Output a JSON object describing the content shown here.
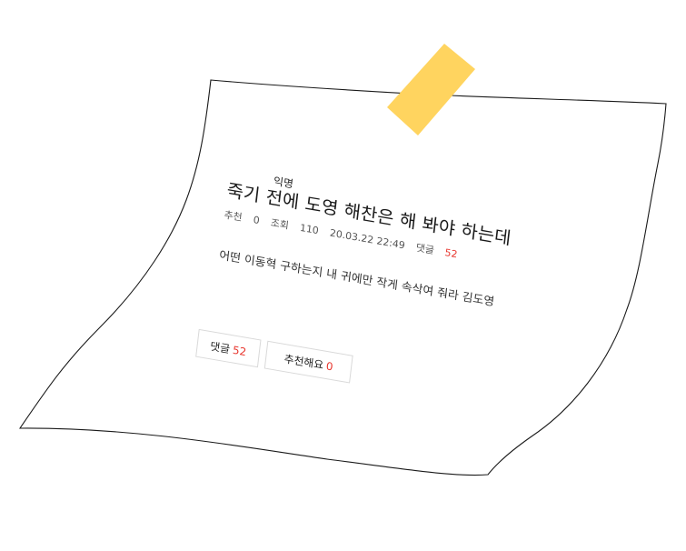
{
  "post": {
    "author": "익명",
    "title": "죽기 전에 도영 해찬은 해 봐야 하는데",
    "meta": {
      "recommend_label": "추천",
      "recommend_count": "0",
      "views_label": "조회",
      "views_count": "110",
      "datetime": "20.03.22 22:49",
      "comments_label": "댓글",
      "comments_count": "52"
    },
    "body": "어떤 이동혁 구하는지 내 귀에만 작게 속삭여 줘라 김도영",
    "buttons": {
      "comment_label": "댓글",
      "comment_count": "52",
      "recommend_label": "추천해요",
      "recommend_count": "0"
    }
  },
  "colors": {
    "tape": "#FFD45F",
    "accent_red": "#e8372f",
    "paper_outline": "#1a1a1a"
  }
}
